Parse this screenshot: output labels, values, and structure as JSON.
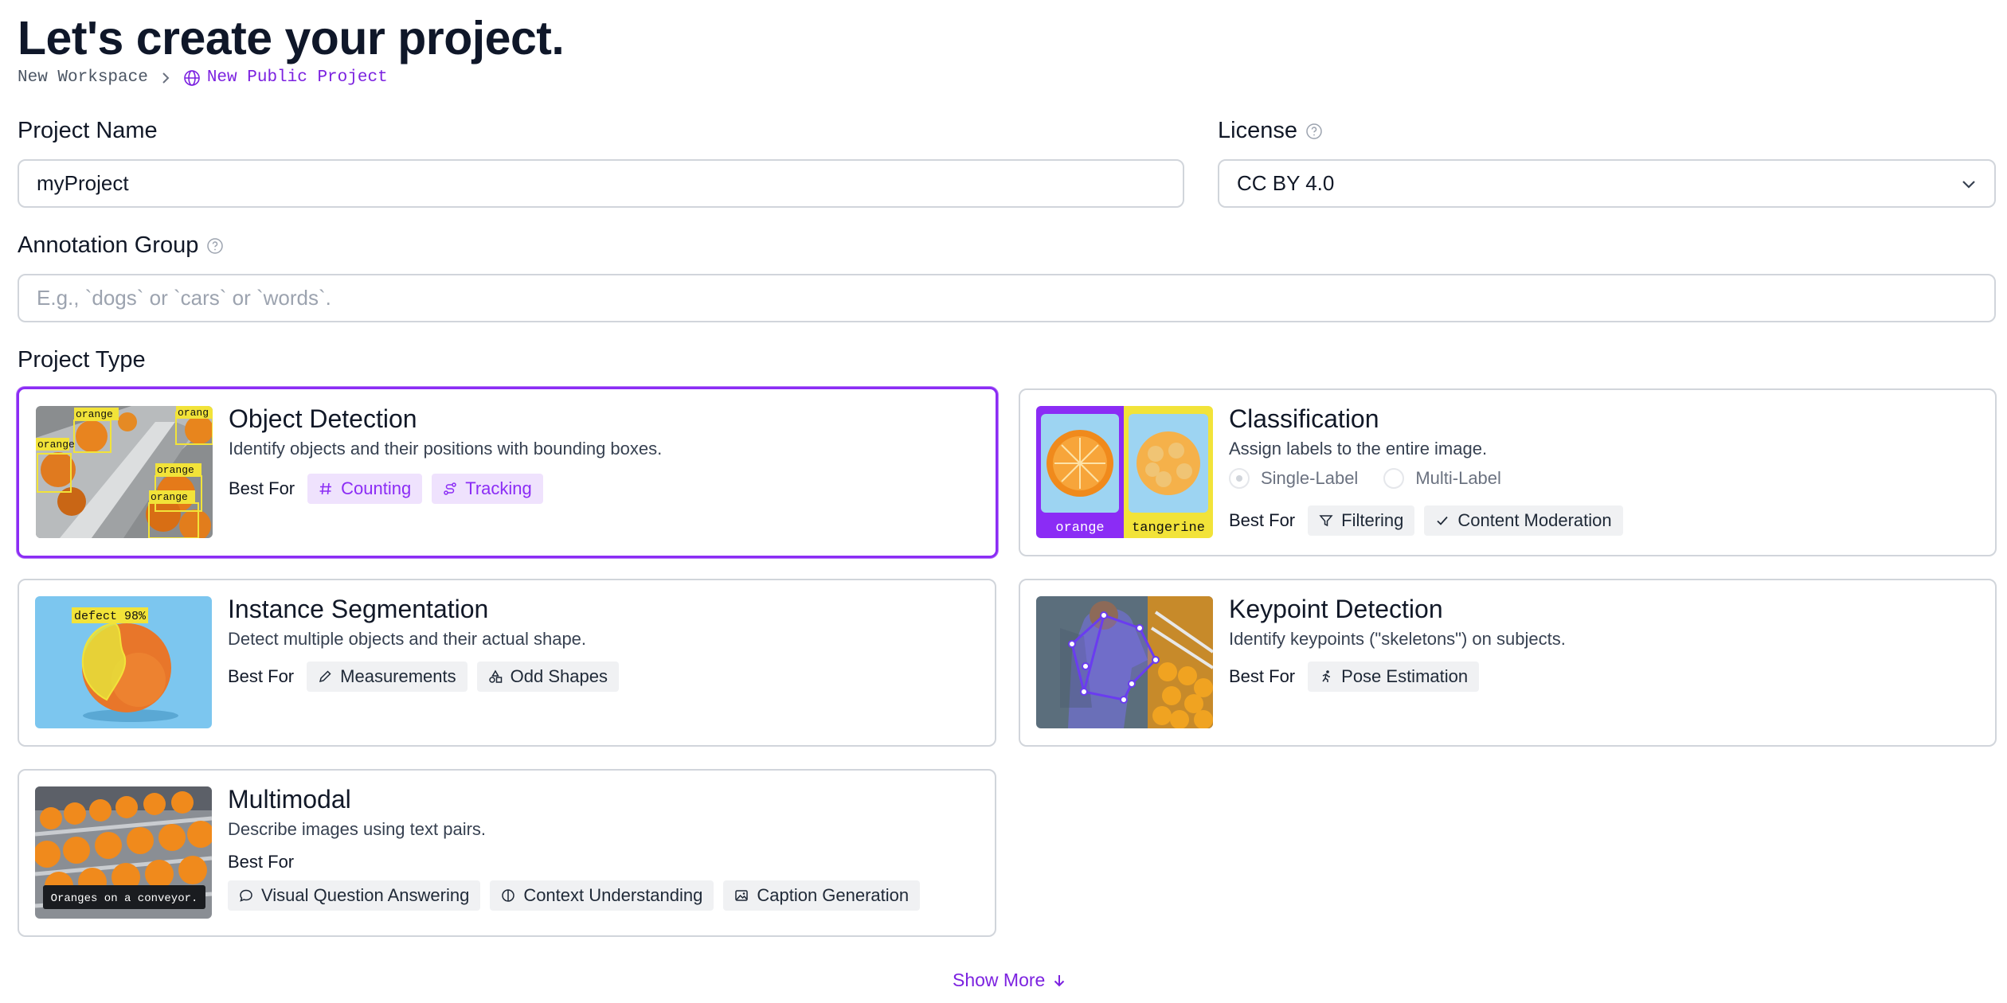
{
  "header": {
    "title": "Let's create your project.",
    "breadcrumb_workspace": "New Workspace",
    "breadcrumb_current": "New Public Project"
  },
  "form": {
    "project_name_label": "Project Name",
    "project_name_value": "myProject",
    "license_label": "License",
    "license_value": "CC BY 4.0",
    "annotation_group_label": "Annotation Group",
    "annotation_group_placeholder": "E.g., `dogs` or `cars` or `words`.",
    "project_type_label": "Project Type"
  },
  "cards": {
    "object_detection": {
      "title": "Object Detection",
      "desc": "Identify objects and their positions with bounding boxes.",
      "best_for": "Best For",
      "tags": [
        "Counting",
        "Tracking"
      ],
      "thumb_labels": [
        "orange",
        "orang",
        "orange",
        "orange",
        "orange"
      ]
    },
    "classification": {
      "title": "Classification",
      "desc": "Assign labels to the entire image.",
      "radio_single": "Single-Label",
      "radio_multi": "Multi-Label",
      "best_for": "Best For",
      "tags": [
        "Filtering",
        "Content Moderation"
      ],
      "thumb_labels": [
        "orange",
        "tangerine"
      ]
    },
    "instance_segmentation": {
      "title": "Instance Segmentation",
      "desc": "Detect multiple objects and their actual shape.",
      "best_for": "Best For",
      "tags": [
        "Measurements",
        "Odd Shapes"
      ],
      "thumb_label": "defect 98%"
    },
    "keypoint_detection": {
      "title": "Keypoint Detection",
      "desc": "Identify keypoints (\"skeletons\") on subjects.",
      "best_for": "Best For",
      "tags": [
        "Pose Estimation"
      ]
    },
    "multimodal": {
      "title": "Multimodal",
      "desc": "Describe images using text pairs.",
      "best_for": "Best For",
      "tags": [
        "Visual Question Answering",
        "Context Understanding",
        "Caption Generation"
      ],
      "thumb_caption": "Oranges on a conveyor."
    }
  },
  "footer": {
    "show_more": "Show More"
  },
  "colors": {
    "accent": "#8b2cf5",
    "chip_bg": "#f0f1f3",
    "chip_purple_bg": "#efe2fd",
    "border": "#d1d5db"
  }
}
